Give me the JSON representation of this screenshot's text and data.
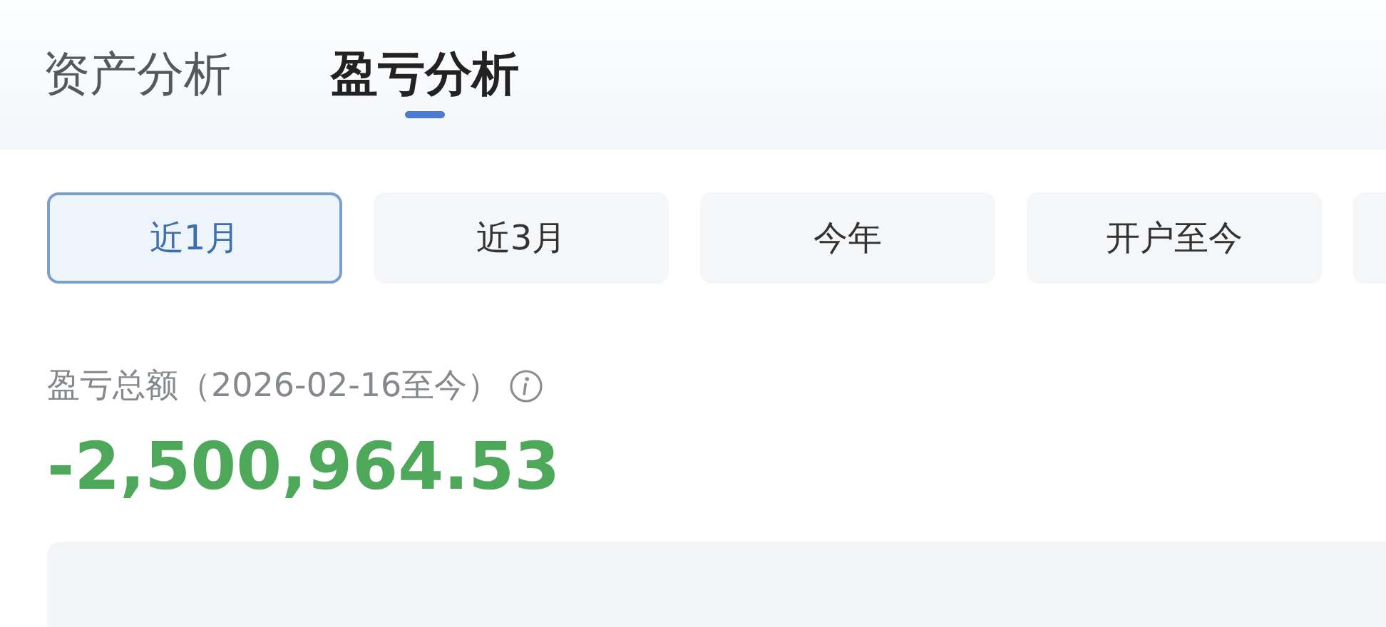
{
  "tabs": [
    {
      "label": "资产分析",
      "selected": false
    },
    {
      "label": "盈亏分析",
      "selected": true
    }
  ],
  "periods": [
    {
      "label": "近1月",
      "selected": true
    },
    {
      "label": "近3月",
      "selected": false
    },
    {
      "label": "今年",
      "selected": false
    },
    {
      "label": "开户至今",
      "selected": false
    }
  ],
  "summary": {
    "label": "盈亏总额（2026-02-16至今）",
    "value": "-2,500,964.53"
  }
}
